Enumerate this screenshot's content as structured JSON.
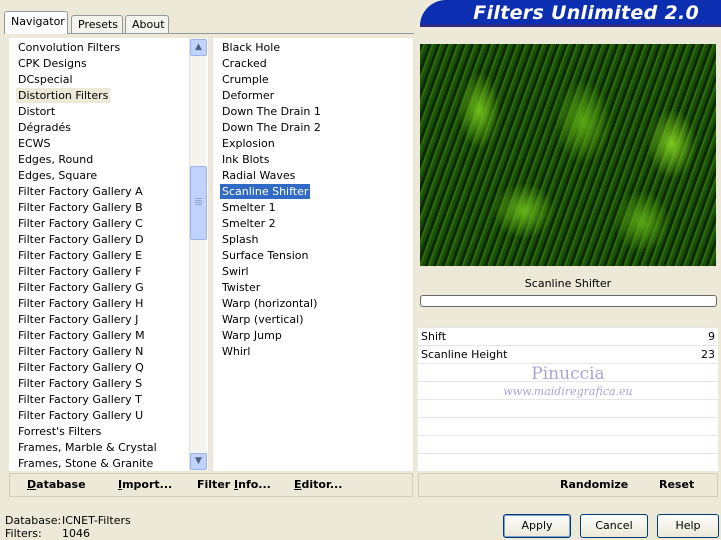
{
  "tabs": [
    {
      "label": "Navigator",
      "active": true
    },
    {
      "label": "Presets",
      "active": false
    },
    {
      "label": "About",
      "active": false
    }
  ],
  "app_title": "Filters Unlimited 2.0",
  "categories": [
    "Convolution Filters",
    "CPK Designs",
    "DCspecial",
    "Distortion Filters",
    "Distort",
    "Dégradés",
    "ECWS",
    "Edges, Round",
    "Edges, Square",
    "Filter Factory Gallery A",
    "Filter Factory Gallery B",
    "Filter Factory Gallery C",
    "Filter Factory Gallery D",
    "Filter Factory Gallery E",
    "Filter Factory Gallery F",
    "Filter Factory Gallery G",
    "Filter Factory Gallery H",
    "Filter Factory Gallery J",
    "Filter Factory Gallery M",
    "Filter Factory Gallery N",
    "Filter Factory Gallery Q",
    "Filter Factory Gallery S",
    "Filter Factory Gallery T",
    "Filter Factory Gallery U",
    "Forrest's Filters",
    "Frames, Marble & Crystal",
    "Frames, Stone & Granite"
  ],
  "selected_category": "Distortion Filters",
  "filters": [
    "Black Hole",
    "Cracked",
    "Crumple",
    "Deformer",
    "Down The Drain 1",
    "Down The Drain 2",
    "Explosion",
    "Ink Blots",
    "Radial Waves",
    "Scanline Shifter",
    "Smelter 1",
    "Smelter 2",
    "Splash",
    "Surface Tension",
    "Swirl",
    "Twister",
    "Warp (horizontal)",
    "Warp (vertical)",
    "Warp Jump",
    "Whirl"
  ],
  "selected_filter": "Scanline Shifter",
  "scrollbar_icons": {
    "up": "▲",
    "down": "▼"
  },
  "filter_name": "Scanline Shifter",
  "parameters": [
    {
      "label": "Shift",
      "value": "9"
    },
    {
      "label": "Scanline Height",
      "value": "23"
    }
  ],
  "watermark": {
    "name": "Pinuccia",
    "url": "www.maidiregrafica.eu"
  },
  "toolbar": {
    "database_first": "D",
    "database_rest": "atabase",
    "import_first": "I",
    "import_rest": "mport...",
    "filterinfo_first": "Filter ",
    "filterinfo_u": "I",
    "filterinfo_rest": "nfo...",
    "editor_first": "E",
    "editor_rest": "ditor...",
    "randomize": "Randomize",
    "reset": "Reset"
  },
  "status": {
    "database_label": "Database:",
    "database_value": "ICNET-Filters",
    "filters_label": "Filters:",
    "filters_value": "1046"
  },
  "buttons": {
    "apply": "Apply",
    "cancel": "Cancel",
    "help": "Help"
  },
  "colors": {
    "selection": "#316ac5",
    "banner": "#0b2fb0"
  }
}
